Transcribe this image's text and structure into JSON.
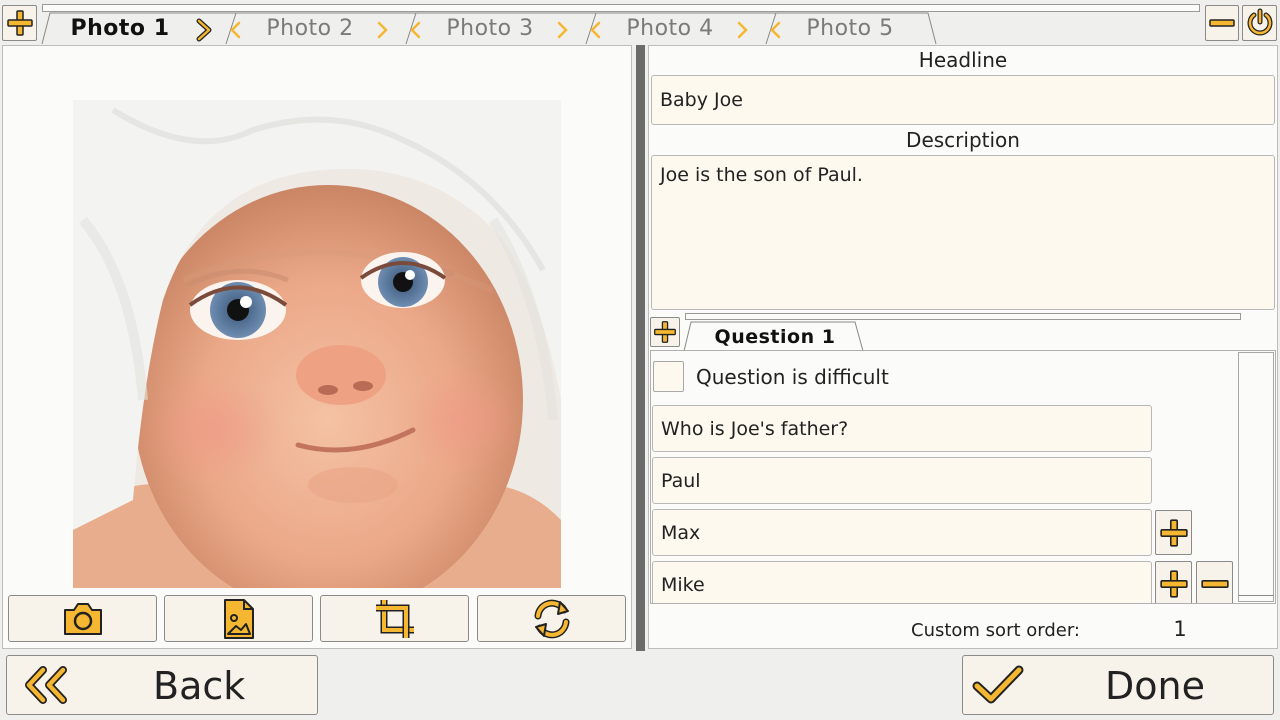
{
  "tabs": [
    {
      "label": "Photo 1",
      "active": true
    },
    {
      "label": "Photo 2",
      "active": false
    },
    {
      "label": "Photo 3",
      "active": false
    },
    {
      "label": "Photo 4",
      "active": false
    },
    {
      "label": "Photo 5",
      "active": false
    }
  ],
  "form": {
    "headline_label": "Headline",
    "headline_value": "Baby Joe",
    "description_label": "Description",
    "description_value": "Joe is the son of Paul."
  },
  "question": {
    "tab_label": "Question 1",
    "difficult_label": "Question is difficult",
    "difficult_checked": false,
    "text": "Who is Joe's father?",
    "answers": [
      "Paul",
      "Max",
      "Mike"
    ]
  },
  "sort": {
    "label": "Custom sort order:",
    "value": "1"
  },
  "buttons": {
    "back": "Back",
    "done": "Done"
  },
  "icons": {
    "add_tab": "plus-icon",
    "remove_tab": "minus-icon",
    "power": "power-icon",
    "camera": "camera-icon",
    "image_file": "image-file-icon",
    "crop": "crop-icon",
    "rotate": "rotate-icon",
    "back": "double-chevron-left-icon",
    "done": "checkmark-icon"
  },
  "colors": {
    "accent": "#f5b731",
    "field_bg": "#fdf9ef",
    "button_bg": "#f7f3ea"
  }
}
